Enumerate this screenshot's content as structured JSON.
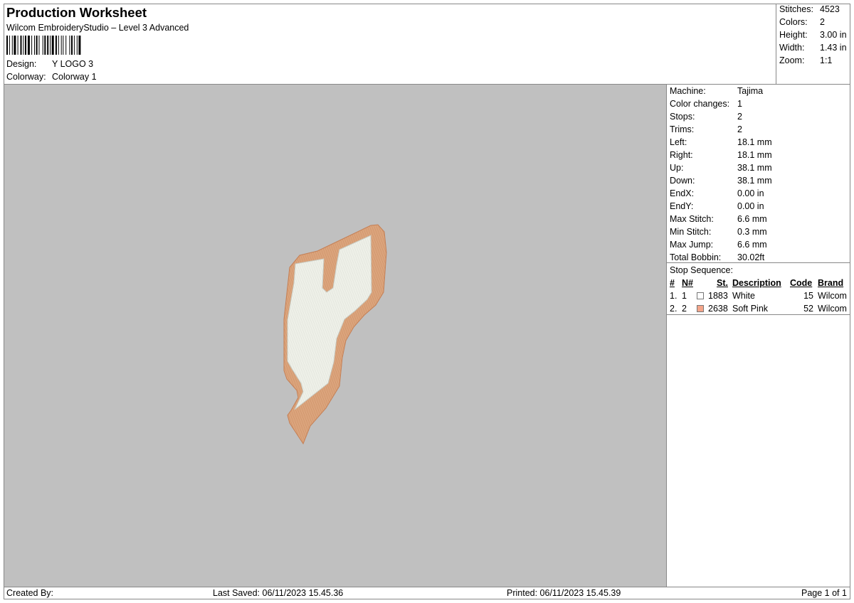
{
  "header": {
    "title": "Production Worksheet",
    "software": "Wilcom EmbroideryStudio – Level 3 Advanced",
    "design_label": "Design:",
    "design_value": "Y LOGO 3",
    "colorway_label": "Colorway:",
    "colorway_value": "Colorway 1"
  },
  "summary": {
    "stitches_label": "Stitches:",
    "stitches_value": "4523",
    "colors_label": "Colors:",
    "colors_value": "2",
    "height_label": "Height:",
    "height_value": "3.00 in",
    "width_label": "Width:",
    "width_value": "1.43 in",
    "zoom_label": "Zoom:",
    "zoom_value": "1:1"
  },
  "machine_info": [
    {
      "label": "Machine:",
      "value": "Tajima"
    },
    {
      "label": "Color changes:",
      "value": "1"
    },
    {
      "label": "Stops:",
      "value": "2"
    },
    {
      "label": "Trims:",
      "value": "2"
    },
    {
      "label": "Left:",
      "value": "18.1 mm"
    },
    {
      "label": "Right:",
      "value": "18.1 mm"
    },
    {
      "label": "Up:",
      "value": "38.1 mm"
    },
    {
      "label": "Down:",
      "value": "38.1 mm"
    },
    {
      "label": "EndX:",
      "value": "0.00 in"
    },
    {
      "label": "EndY:",
      "value": "0.00 in"
    },
    {
      "label": "Max Stitch:",
      "value": "6.6 mm"
    },
    {
      "label": "Min Stitch:",
      "value": "0.3 mm"
    },
    {
      "label": "Max Jump:",
      "value": "6.6 mm"
    },
    {
      "label": "Total Bobbin:",
      "value": "30.02ft"
    }
  ],
  "stop_sequence": {
    "title": "Stop Sequence:",
    "headers": {
      "num": "#",
      "n_num": "N#",
      "st": "St.",
      "description": "Description",
      "code": "Code",
      "brand": "Brand"
    },
    "rows": [
      {
        "num": "1.",
        "n": "1",
        "color": "#ffffff",
        "st": "1883",
        "description": "White",
        "code": "15",
        "brand": "Wilcom"
      },
      {
        "num": "2.",
        "n": "2",
        "color": "#f4a58a",
        "st": "2638",
        "description": "Soft Pink",
        "code": "52",
        "brand": "Wilcom"
      }
    ]
  },
  "footer": {
    "created_by": "Created By:",
    "last_saved": "Last Saved: 06/11/2023 15.45.36",
    "printed": "Printed: 06/11/2023 15.45.39",
    "page": "Page 1 of 1"
  },
  "colors": {
    "canvas_bg": "#c0c0c0",
    "thread_white": "#ecede5",
    "thread_pink": "#d9a078"
  }
}
